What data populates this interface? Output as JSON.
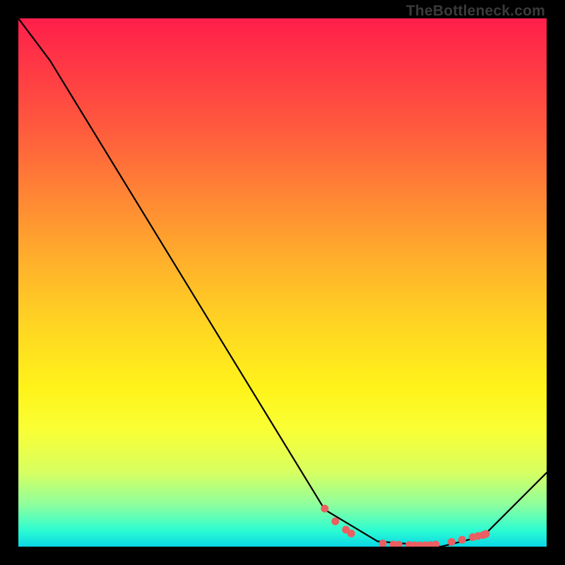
{
  "watermark": "TheBottleneck.com",
  "chart_data": {
    "type": "line",
    "x": [
      0,
      6,
      58,
      68,
      80,
      88,
      100
    ],
    "values": [
      100,
      92,
      7,
      1,
      0,
      2,
      14
    ],
    "xlim": [
      0,
      100
    ],
    "ylim": [
      0,
      100
    ],
    "title": "",
    "xlabel": "",
    "ylabel": "",
    "markers": {
      "x": [
        58,
        60,
        62,
        63,
        69,
        71,
        72,
        74,
        75,
        76,
        77,
        78,
        79,
        82,
        84,
        86,
        87,
        88,
        88.5
      ],
      "y": [
        7.2,
        4.8,
        3.2,
        2.5,
        0.6,
        0.4,
        0.35,
        0.3,
        0.25,
        0.25,
        0.25,
        0.3,
        0.4,
        0.9,
        1.3,
        1.8,
        2.0,
        2.2,
        2.4
      ]
    },
    "marker_color": "#e95f62",
    "line_color": "#000000"
  }
}
